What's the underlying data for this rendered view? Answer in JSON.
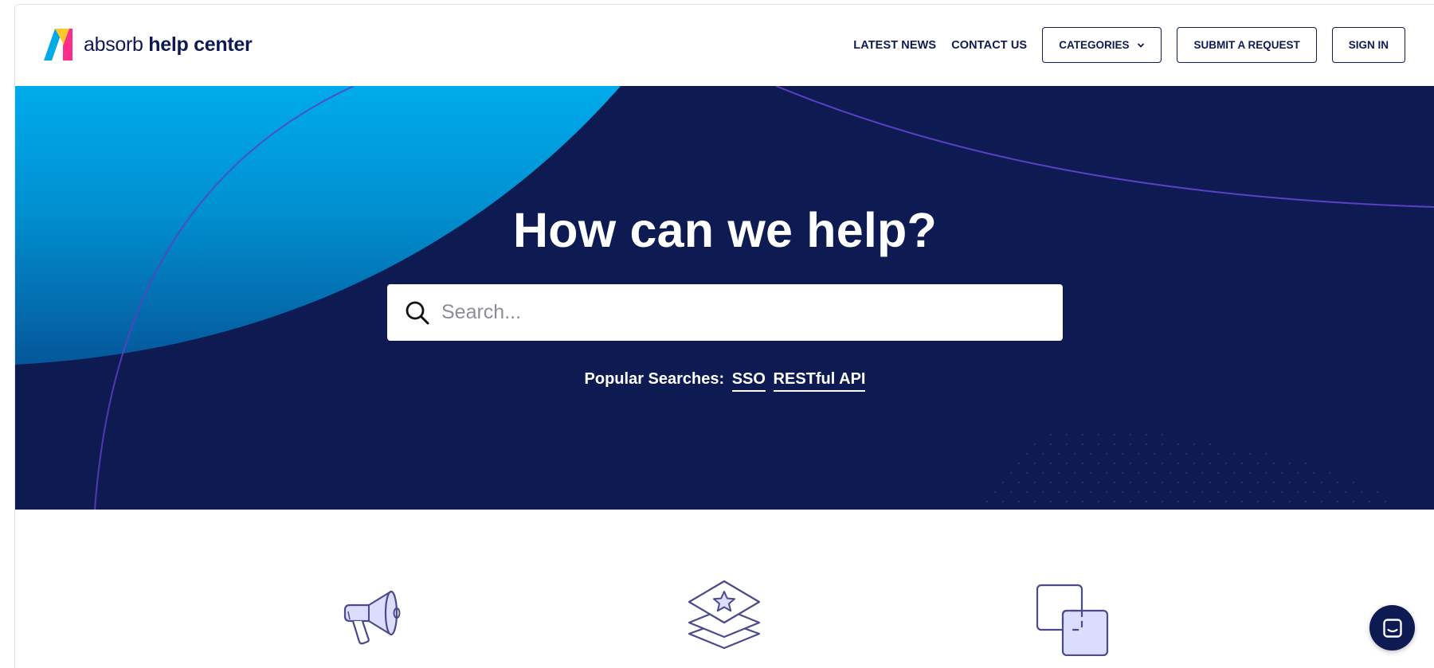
{
  "brand": {
    "logo_light": "absorb",
    "logo_bold": "help center",
    "logo_icon": "absorb-logo-icon"
  },
  "nav": {
    "latest_news": "LATEST NEWS",
    "contact_us": "CONTACT US",
    "categories": "CATEGORIES",
    "submit_request": "SUBMIT A REQUEST",
    "sign_in": "SIGN IN"
  },
  "hero": {
    "title": "How can we help?",
    "search_placeholder": "Search...",
    "popular_label": "Popular Searches:",
    "popular_links": [
      "SSO",
      "RESTful API"
    ]
  },
  "features": {
    "icons": [
      "megaphone-icon",
      "layers-star-icon",
      "overlapping-squares-icon"
    ]
  },
  "chat": {
    "icon": "chat-icon"
  },
  "colors": {
    "navy": "#0e1a52",
    "cyan": "#00a9e8",
    "purple_line": "#5b3fc4",
    "icon_outline": "#4a4a8c",
    "icon_fill": "#dcdcff"
  }
}
